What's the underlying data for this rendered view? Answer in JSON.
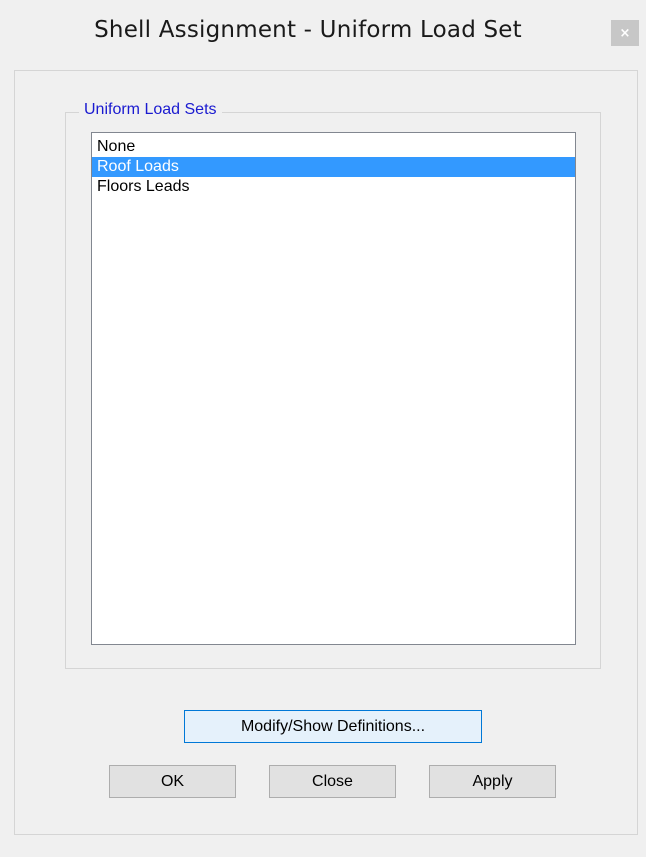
{
  "window": {
    "title": "Shell Assignment - Uniform Load Set",
    "close_glyph": "×"
  },
  "group": {
    "legend": "Uniform Load Sets"
  },
  "list": {
    "items": [
      {
        "label": "None",
        "selected": false
      },
      {
        "label": "Roof Loads",
        "selected": true
      },
      {
        "label": "Floors Leads",
        "selected": false
      }
    ]
  },
  "buttons": {
    "modify_show": "Modify/Show Definitions...",
    "ok": "OK",
    "close": "Close",
    "apply": "Apply"
  },
  "colors": {
    "selection": "#3399ff",
    "legend_text": "#1a1ad0",
    "focused_button_border": "#0078d7"
  }
}
